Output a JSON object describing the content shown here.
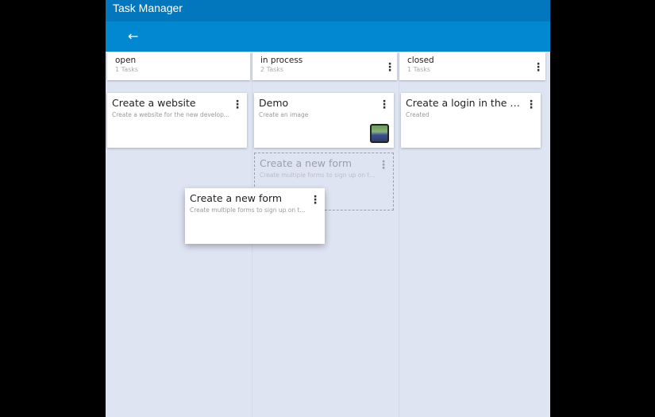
{
  "app": {
    "title": "Task Manager",
    "back_icon": "arrow-left"
  },
  "columns": [
    {
      "name": "open",
      "count": "1 Tasks"
    },
    {
      "name": "in process",
      "count": "2 Tasks"
    },
    {
      "name": "closed",
      "count": "1 Tasks"
    }
  ],
  "cards": {
    "website": {
      "title": "Create a website",
      "desc": "Create a website for the new develop..."
    },
    "demo": {
      "title": "Demo",
      "desc": "Create an image"
    },
    "login": {
      "title": "Create a login in the ta...",
      "desc": "Created"
    },
    "form_placeholder": {
      "title": "Create a new form",
      "desc": "Create multiple forms to sign up on t..."
    },
    "form_dragging": {
      "title": "Create a new form",
      "desc": "Create multiple forms to sign up on t..."
    }
  }
}
